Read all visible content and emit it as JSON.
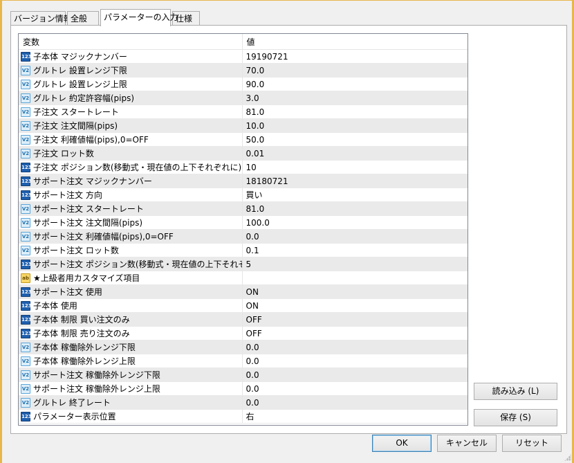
{
  "tabs": [
    "バージョン情報",
    "全般",
    "パラメーターの入力",
    "仕様"
  ],
  "table": {
    "headers": [
      "変数",
      "値"
    ],
    "rows": [
      {
        "icon": "123",
        "type": "int",
        "name": "子本体 マジックナンバー",
        "value": "19190721"
      },
      {
        "icon": "V2",
        "type": "dbl",
        "name": "グルトレ 設置レンジ下限",
        "value": "70.0"
      },
      {
        "icon": "V2",
        "type": "dbl",
        "name": "グルトレ 設置レンジ上限",
        "value": "90.0"
      },
      {
        "icon": "V2",
        "type": "dbl",
        "name": "グルトレ 約定許容幅(pips)",
        "value": "3.0"
      },
      {
        "icon": "V2",
        "type": "dbl",
        "name": "子注文 スタートレート",
        "value": "81.0"
      },
      {
        "icon": "V2",
        "type": "dbl",
        "name": "子注文 注文間隔(pips)",
        "value": "10.0"
      },
      {
        "icon": "V2",
        "type": "dbl",
        "name": "子注文 利確値幅(pips),0=OFF",
        "value": "50.0"
      },
      {
        "icon": "V2",
        "type": "dbl",
        "name": "子注文 ロット数",
        "value": "0.01"
      },
      {
        "icon": "123",
        "type": "int",
        "name": "子注文 ポジション数(移動式・現在値の上下それぞれに)",
        "value": "10"
      },
      {
        "icon": "123",
        "type": "int",
        "name": "サポート注文 マジックナンバー",
        "value": "18180721"
      },
      {
        "icon": "123",
        "type": "int",
        "name": "サポート注文 方向",
        "value": "買い"
      },
      {
        "icon": "V2",
        "type": "dbl",
        "name": "サポート注文 スタートレート",
        "value": "81.0"
      },
      {
        "icon": "V2",
        "type": "dbl",
        "name": "サポート注文 注文間隔(pips)",
        "value": "100.0"
      },
      {
        "icon": "V2",
        "type": "dbl",
        "name": "サポート注文 利確値幅(pips),0=OFF",
        "value": "0.0"
      },
      {
        "icon": "V2",
        "type": "dbl",
        "name": "サポート注文 ロット数",
        "value": "0.1"
      },
      {
        "icon": "123",
        "type": "int",
        "name": "サポート注文 ポジション数(移動式・現在値の上下それぞれに)",
        "value": "5"
      },
      {
        "icon": "ab",
        "type": "str",
        "name": "★上級者用カスタマイズ項目",
        "value": ""
      },
      {
        "icon": "123",
        "type": "int",
        "name": "サポート注文 使用",
        "value": "ON"
      },
      {
        "icon": "123",
        "type": "int",
        "name": "子本体 使用",
        "value": "ON"
      },
      {
        "icon": "123",
        "type": "int",
        "name": "子本体 制限 買い注文のみ",
        "value": "OFF"
      },
      {
        "icon": "123",
        "type": "int",
        "name": "子本体 制限 売り注文のみ",
        "value": "OFF"
      },
      {
        "icon": "V2",
        "type": "dbl",
        "name": "子本体 稼働除外レンジ下限",
        "value": "0.0"
      },
      {
        "icon": "V2",
        "type": "dbl",
        "name": "子本体 稼働除外レンジ上限",
        "value": "0.0"
      },
      {
        "icon": "V2",
        "type": "dbl",
        "name": "サポート注文 稼働除外レンジ下限",
        "value": "0.0"
      },
      {
        "icon": "V2",
        "type": "dbl",
        "name": "サポート注文 稼働除外レンジ上限",
        "value": "0.0"
      },
      {
        "icon": "V2",
        "type": "dbl",
        "name": "グルトレ 終了レート",
        "value": "0.0"
      },
      {
        "icon": "123",
        "type": "int",
        "name": "パラメーター表示位置",
        "value": "右"
      }
    ]
  },
  "side_buttons": {
    "load": "読み込み (L)",
    "save": "保存 (S)"
  },
  "footer_buttons": {
    "ok": "OK",
    "cancel": "キャンセル",
    "reset": "リセット"
  },
  "colors": {
    "window_border": "#e9b64a",
    "row_alt": "#eaeaea",
    "default_button_border": "#3c7fb1"
  }
}
